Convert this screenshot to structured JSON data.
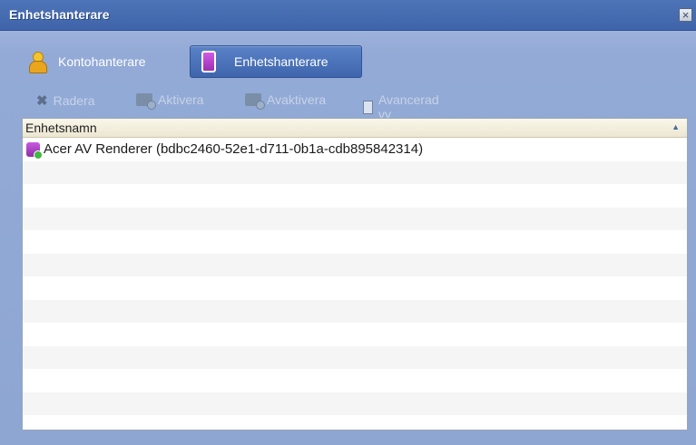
{
  "window": {
    "title": "Enhetshanterare",
    "close_glyph": "×"
  },
  "tabs": [
    {
      "label": "Kontohanterare",
      "icon": "user-icon",
      "active": false
    },
    {
      "label": "Enhetshanterare",
      "icon": "device-icon",
      "active": true
    }
  ],
  "toolbar": {
    "delete_label": "Radera",
    "activate_label": "Aktivera",
    "deactivate_label": "Avaktivera",
    "advanced_label": "Avancerad vy"
  },
  "list": {
    "header": "Enhetsnamn",
    "sort_glyph": "▲",
    "rows": [
      {
        "name": "Acer AV Renderer (bdbc2460-52e1-d711-0b1a-cdb895842314)",
        "status": "active"
      }
    ]
  },
  "colors": {
    "titlebar": "#4e74b8",
    "active_tab": "#4f76bd",
    "device_icon": "#b146cc",
    "status_ok": "#3fb83f"
  }
}
